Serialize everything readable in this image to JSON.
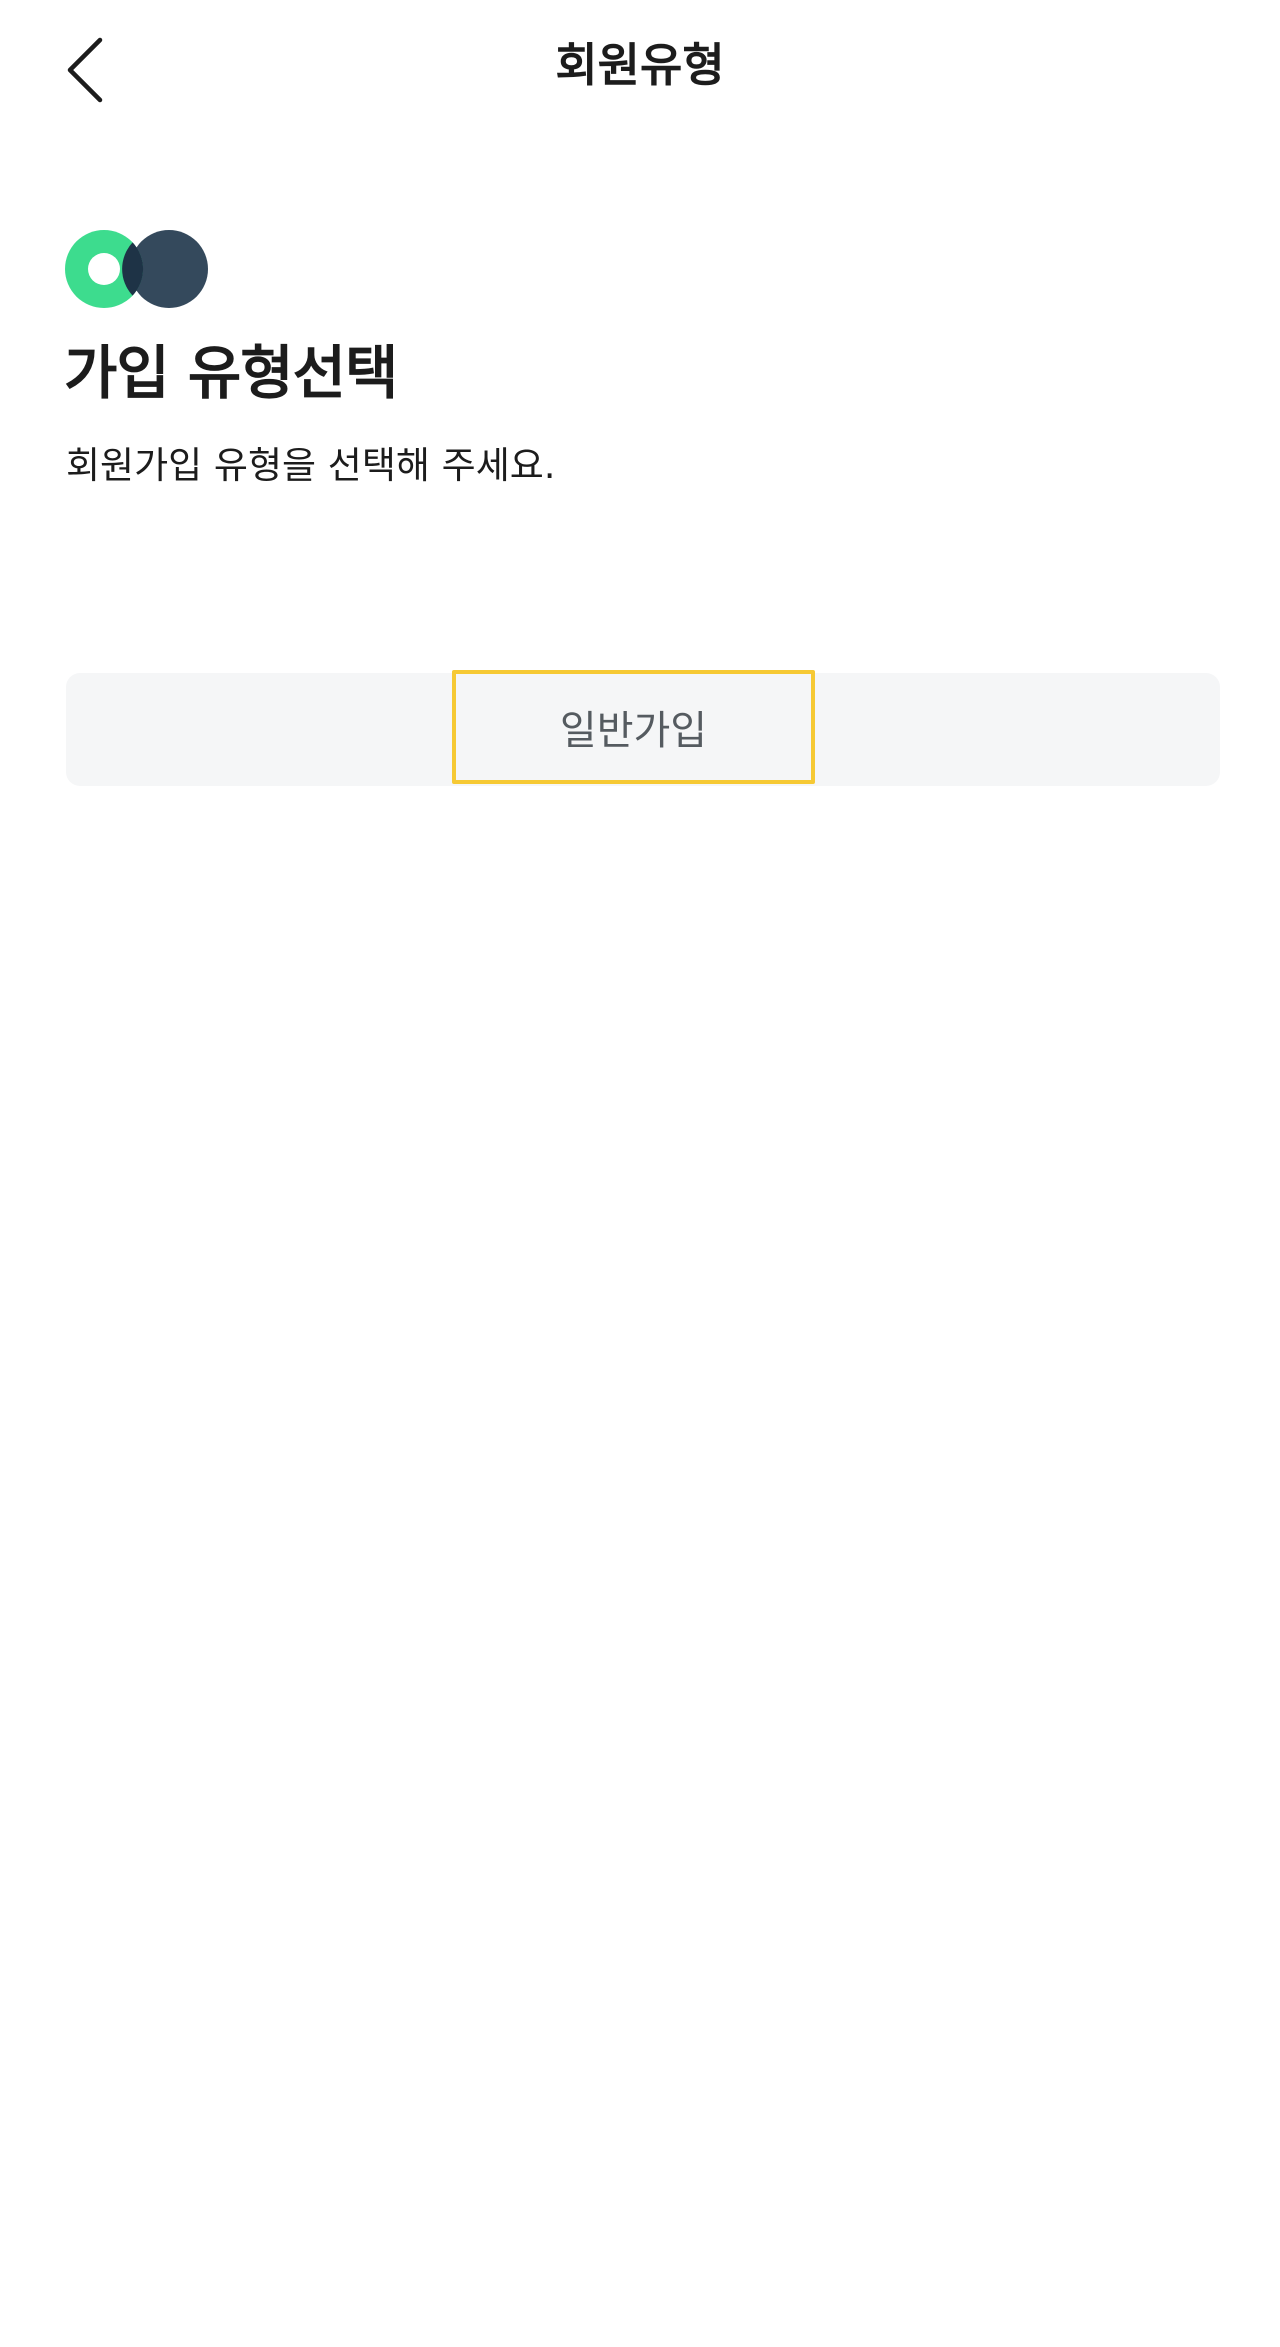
{
  "header": {
    "back_icon": "chevron-left-icon",
    "title": "회원유형"
  },
  "logo": {
    "icon": "two-circles-logo",
    "colors": {
      "ring": "#3ddc8e",
      "ring_inner": "#ffffff",
      "dark_circle": "#34495c"
    }
  },
  "main": {
    "title": "가입 유형선택",
    "subtitle": "회원가입 유형을 선택해 주세요."
  },
  "signup_options": {
    "general_label": "일반가입",
    "highlight_color": "#f6c934",
    "bar_color": "#f5f6f7"
  }
}
